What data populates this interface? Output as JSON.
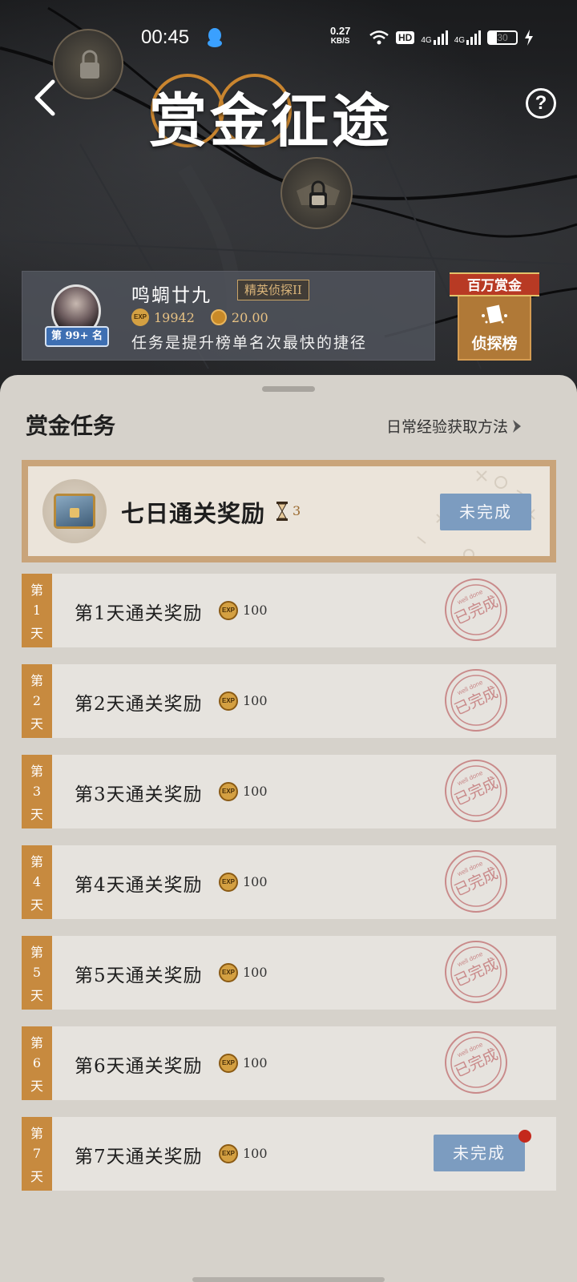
{
  "status_bar": {
    "time": "00:45",
    "speed_value": "0.27",
    "speed_unit": "KB/S",
    "hd_label": "HD",
    "net1": "4G",
    "net2": "4G",
    "battery": "30"
  },
  "header": {
    "title": "赏金征途",
    "help_label": "?"
  },
  "profile": {
    "name": "鸣蜩廿九",
    "title_badge": "精英侦探II",
    "rank": "第 99+ 名",
    "exp_icon_label": "EXP",
    "exp_value": "19942",
    "coin_value": "20.00",
    "tagline": "任务是提升榜单名次最快的捷径"
  },
  "leaderboard_button": {
    "ribbon": "百万赏金",
    "label": "侦探榜"
  },
  "tasks": {
    "section_title": "赏金任务",
    "exp_link": "日常经验获取方法",
    "bonus": {
      "title": "七日通关奖励",
      "count": "3",
      "status": "未完成"
    },
    "stamp_text": "已完成",
    "stamp_subtext": "well done",
    "days": [
      {
        "tab": [
          "第",
          "1",
          "天"
        ],
        "label": "第1天通关奖励",
        "exp_icon": "EXP",
        "exp": "100",
        "status": "已完成",
        "completed": true
      },
      {
        "tab": [
          "第",
          "2",
          "天"
        ],
        "label": "第2天通关奖励",
        "exp_icon": "EXP",
        "exp": "100",
        "status": "已完成",
        "completed": true
      },
      {
        "tab": [
          "第",
          "3",
          "天"
        ],
        "label": "第3天通关奖励",
        "exp_icon": "EXP",
        "exp": "100",
        "status": "已完成",
        "completed": true
      },
      {
        "tab": [
          "第",
          "4",
          "天"
        ],
        "label": "第4天通关奖励",
        "exp_icon": "EXP",
        "exp": "100",
        "status": "已完成",
        "completed": true
      },
      {
        "tab": [
          "第",
          "5",
          "天"
        ],
        "label": "第5天通关奖励",
        "exp_icon": "EXP",
        "exp": "100",
        "status": "已完成",
        "completed": true
      },
      {
        "tab": [
          "第",
          "6",
          "天"
        ],
        "label": "第6天通关奖励",
        "exp_icon": "EXP",
        "exp": "100",
        "status": "已完成",
        "completed": true
      },
      {
        "tab": [
          "第",
          "7",
          "天"
        ],
        "label": "第7天通关奖励",
        "exp_icon": "EXP",
        "exp": "100",
        "status": "未完成",
        "completed": false
      }
    ]
  },
  "colors": {
    "accent_orange": "#c78a3f",
    "button_blue": "#7c9cc0",
    "stamp_red": "#c98a8a",
    "ribbon_red": "#b83a24"
  }
}
